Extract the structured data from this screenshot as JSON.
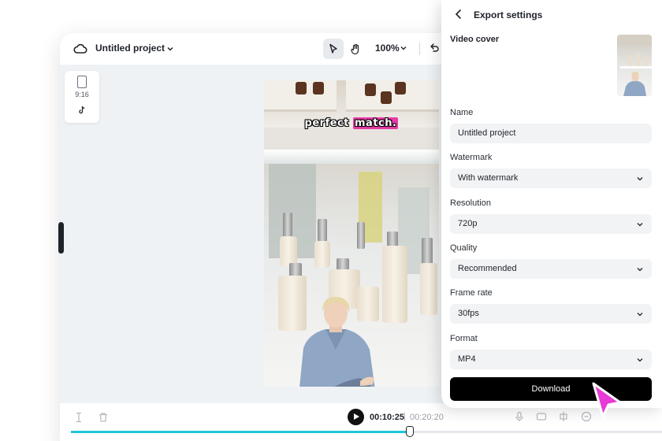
{
  "editor": {
    "project_title": "Untitled project",
    "zoom": "100%",
    "ratio_label": "9:16"
  },
  "video": {
    "caption_normal": "perfect ",
    "caption_highlight": "match."
  },
  "playback": {
    "current_time": "00:10:25",
    "total_time": "00:20:20",
    "progress_fraction": 0.57
  },
  "export_panel": {
    "title": "Export settings",
    "video_cover_label": "Video cover",
    "fields": [
      {
        "label": "Name",
        "value": "Untitled project",
        "dropdown": false
      },
      {
        "label": "Watermark",
        "value": "With watermark",
        "dropdown": true
      },
      {
        "label": "Resolution",
        "value": "720p",
        "dropdown": true
      },
      {
        "label": "Quality",
        "value": "Recommended",
        "dropdown": true
      },
      {
        "label": "Frame rate",
        "value": "30fps",
        "dropdown": true
      },
      {
        "label": "Format",
        "value": "MP4",
        "dropdown": true
      }
    ],
    "download_label": "Download"
  },
  "colors": {
    "accent_cursor": "#e83ad6",
    "caption_highlight": "#e83aa6",
    "progress": "#20c6d8"
  },
  "icons": [
    "cloud-icon",
    "chevron-down-icon",
    "select-pointer-icon",
    "hand-icon",
    "undo-icon",
    "phone-ratio-icon",
    "tiktok-icon",
    "back-chevron-icon",
    "split-icon",
    "trash-icon",
    "play-icon",
    "mic-icon",
    "cursor-arrow-icon"
  ]
}
